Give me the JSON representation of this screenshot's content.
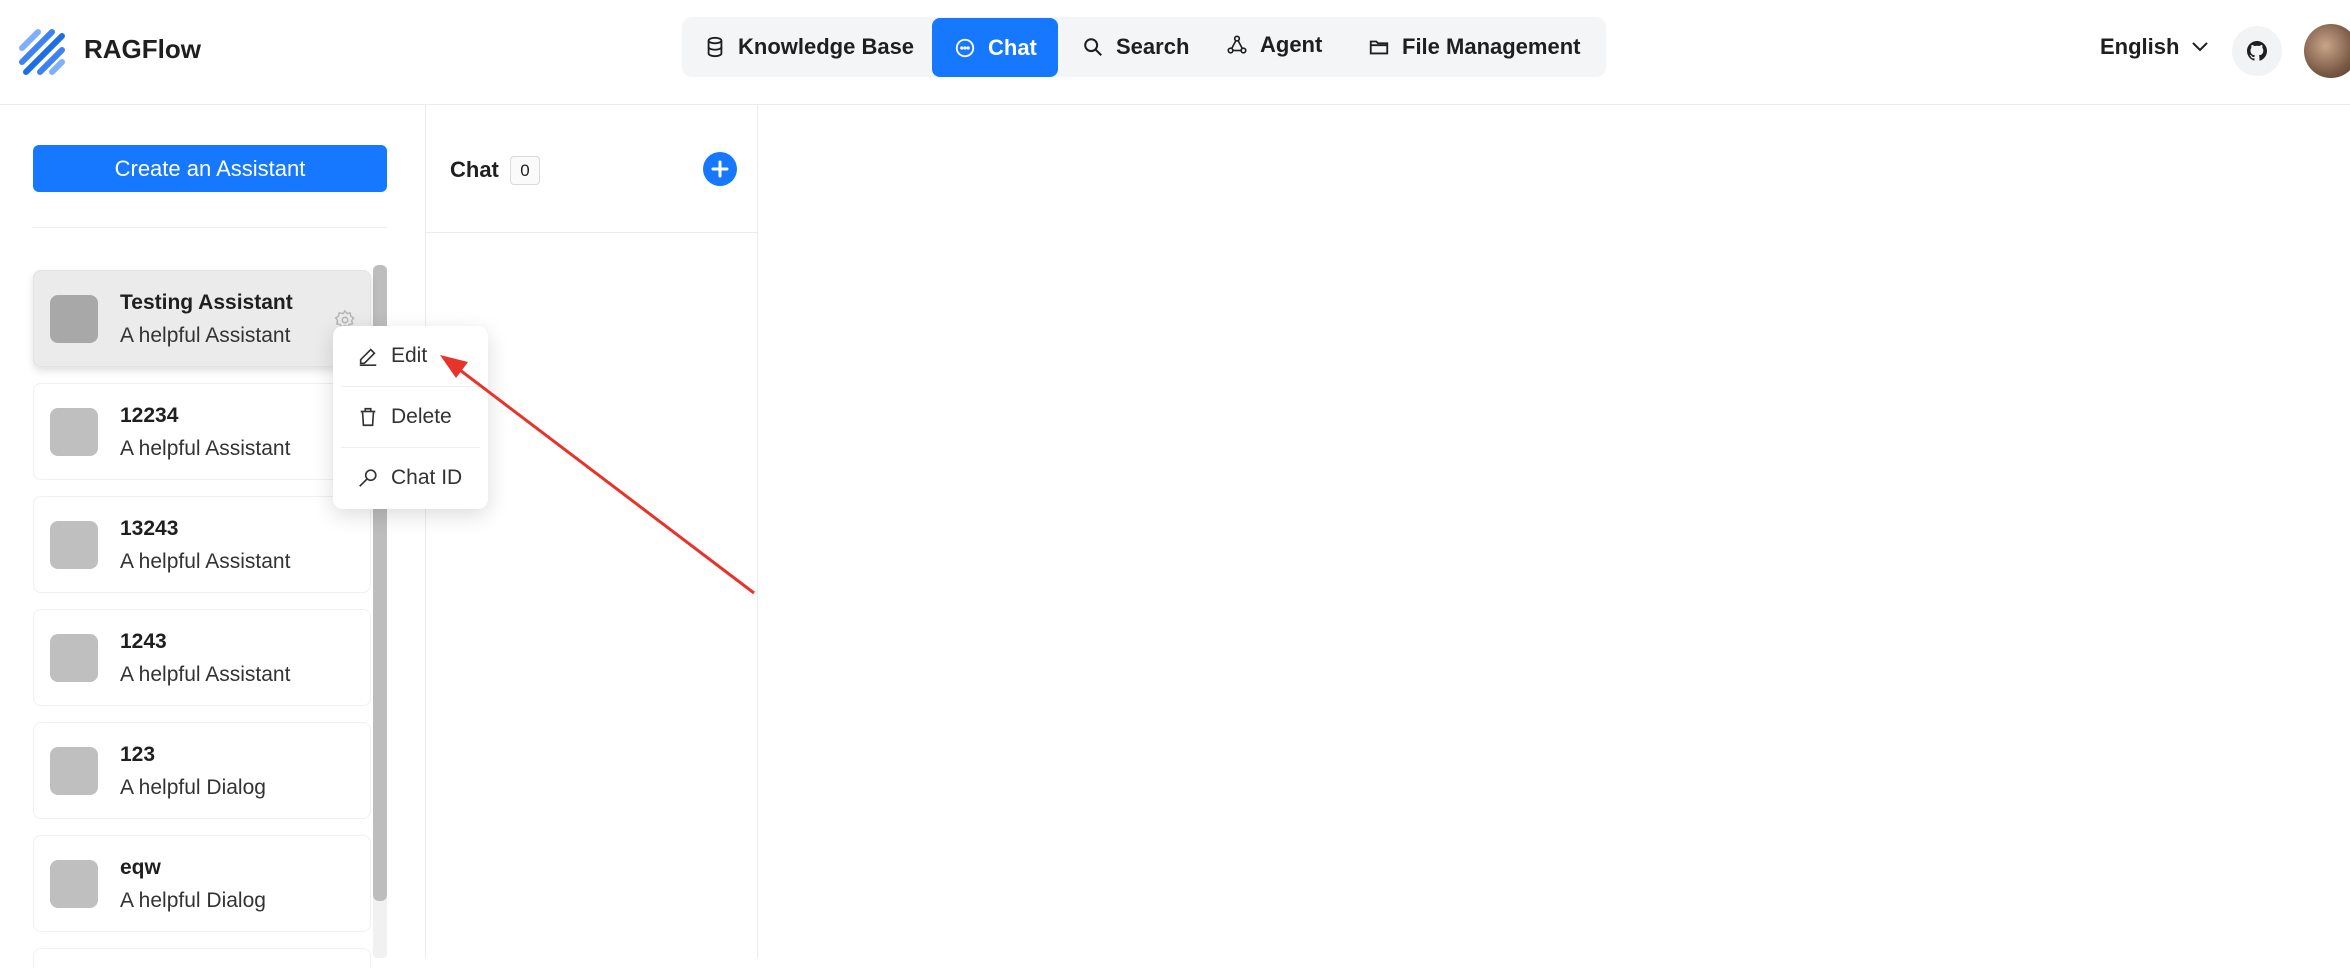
{
  "app": {
    "name": "RAGFlow"
  },
  "nav": {
    "items": [
      {
        "label": "Knowledge Base",
        "icon": "database-icon"
      },
      {
        "label": "Chat",
        "icon": "chat-icon",
        "active": true
      },
      {
        "label": "Search",
        "icon": "search-icon"
      },
      {
        "label": "Agent",
        "icon": "agent-graph-icon"
      },
      {
        "label": "File Management",
        "icon": "folder-icon"
      }
    ]
  },
  "header": {
    "language": "English"
  },
  "sidebar": {
    "create_label": "Create an Assistant",
    "assistants": [
      {
        "name": "Testing Assistant",
        "description": "A helpful Assistant"
      },
      {
        "name": "12234",
        "description": "A helpful Assistant"
      },
      {
        "name": "13243",
        "description": "A helpful Assistant"
      },
      {
        "name": "1243",
        "description": "A helpful Assistant"
      },
      {
        "name": "123",
        "description": "A helpful Dialog"
      },
      {
        "name": "eqw",
        "description": "A helpful Dialog"
      }
    ]
  },
  "chat": {
    "title": "Chat",
    "count": "0"
  },
  "menu": {
    "edit": "Edit",
    "delete": "Delete",
    "chat_id": "Chat ID"
  },
  "colors": {
    "accent": "#1677ff",
    "annotation": "#e8332a"
  }
}
